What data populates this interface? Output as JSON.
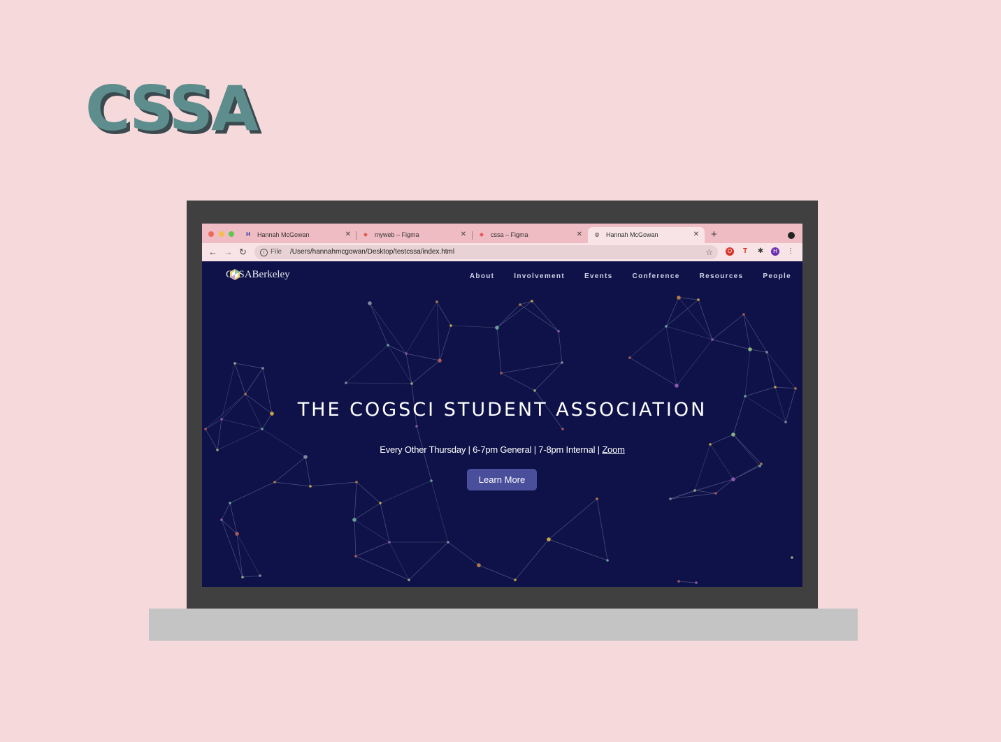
{
  "brand": {
    "logo_text": "CSSA"
  },
  "browser": {
    "tabs": [
      {
        "title": "Hannah McGowan",
        "favicon": "hm"
      },
      {
        "title": "myweb – Figma",
        "favicon": "figma"
      },
      {
        "title": "cssa – Figma",
        "favicon": "figma"
      },
      {
        "title": "Hannah McGowan",
        "favicon": "globe",
        "active": true
      }
    ],
    "address": {
      "scheme_label": "File",
      "url": "/Users/hannahmcgowan/Desktop/testcssa/index.html"
    },
    "profile_initial": "H"
  },
  "site": {
    "logo_left": "CSSA",
    "logo_right": "Berkeley",
    "nav": [
      "About",
      "Involvement",
      "Events",
      "Conference",
      "Resources",
      "People"
    ],
    "hero": {
      "title": "THE COGSCI STUDENT ASSOCIATION",
      "subtitle_text": "Every Other Thursday | 6-7pm General | 7-8pm Internal | ",
      "subtitle_link": "Zoom",
      "button": "Learn More"
    }
  },
  "colors": {
    "page_background": "#f6dadb",
    "logo_teal": "#5e8d8e",
    "site_background": "#0e1248",
    "button": "#4a4f9c",
    "tabbar": "#f0bcc3"
  }
}
